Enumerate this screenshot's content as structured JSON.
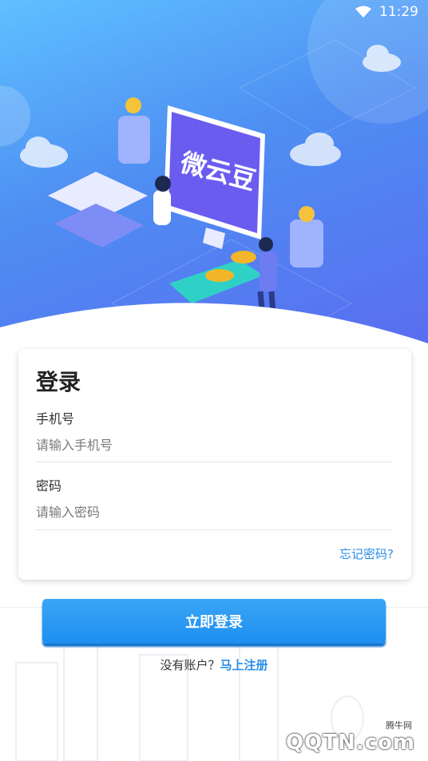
{
  "status": {
    "time": "11:29",
    "wifi_icon": "wifi-icon"
  },
  "hero": {
    "brand_text": "微云豆",
    "colors": {
      "sky_top": "#5fc0ff",
      "sky_bottom": "#5a6cf0"
    }
  },
  "login": {
    "title": "登录",
    "phone_label": "手机号",
    "phone_placeholder": "请输入手机号",
    "phone_value": "",
    "password_label": "密码",
    "password_placeholder": "请输入密码",
    "password_value": "",
    "forgot_text": "忘记密码?",
    "submit_label": "立即登录"
  },
  "signup": {
    "prompt": "没有账户？",
    "link": "马上注册"
  },
  "watermark": {
    "site_name": "腾牛网",
    "logo": "QQTN.com"
  },
  "colors": {
    "accent": "#2a8ee6",
    "button": "#1e8ff0"
  }
}
